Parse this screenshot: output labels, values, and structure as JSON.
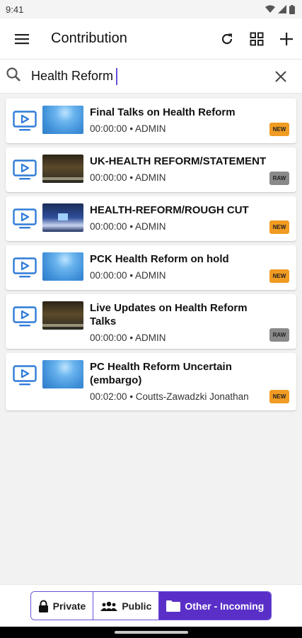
{
  "status_bar": {
    "time": "9:41"
  },
  "app_bar": {
    "title": "Contribution"
  },
  "search": {
    "value": "Health Reform"
  },
  "items": [
    {
      "title": "Final Talks on Health Reform",
      "duration": "00:00:00",
      "author": "ADMIN",
      "badge": "NEW",
      "thumb": "blue"
    },
    {
      "title": "UK-HEALTH REFORM/STATEMENT",
      "duration": "00:00:00",
      "author": "ADMIN",
      "badge": "RAW",
      "thumb": "news"
    },
    {
      "title": "HEALTH-REFORM/ROUGH CUT",
      "duration": "00:00:00",
      "author": "ADMIN",
      "badge": "NEW",
      "thumb": "stage"
    },
    {
      "title": "PCK Health Reform on hold",
      "duration": "00:00:00",
      "author": "ADMIN",
      "badge": "NEW",
      "thumb": "blue"
    },
    {
      "title": "Live Updates on Health Reform Talks",
      "duration": "00:00:00",
      "author": "ADMIN",
      "badge": "RAW",
      "thumb": "news"
    },
    {
      "title": "PC Health Reform Uncertain (embargo)",
      "duration": "00:02:00",
      "author": "Coutts-Zawadzki Jonathan",
      "badge": "NEW",
      "thumb": "blue"
    }
  ],
  "meta_separator": " • ",
  "segments": [
    {
      "label": "Private",
      "icon": "lock-icon",
      "active": false
    },
    {
      "label": "Public",
      "icon": "people-icon",
      "active": false
    },
    {
      "label": "Other - Incoming",
      "icon": "folder-icon",
      "active": true
    }
  ],
  "colors": {
    "accent": "#5a2fc8",
    "badge_new": "#f09b22",
    "badge_raw": "#8a8a8a",
    "tv_icon": "#2f7cd8"
  }
}
